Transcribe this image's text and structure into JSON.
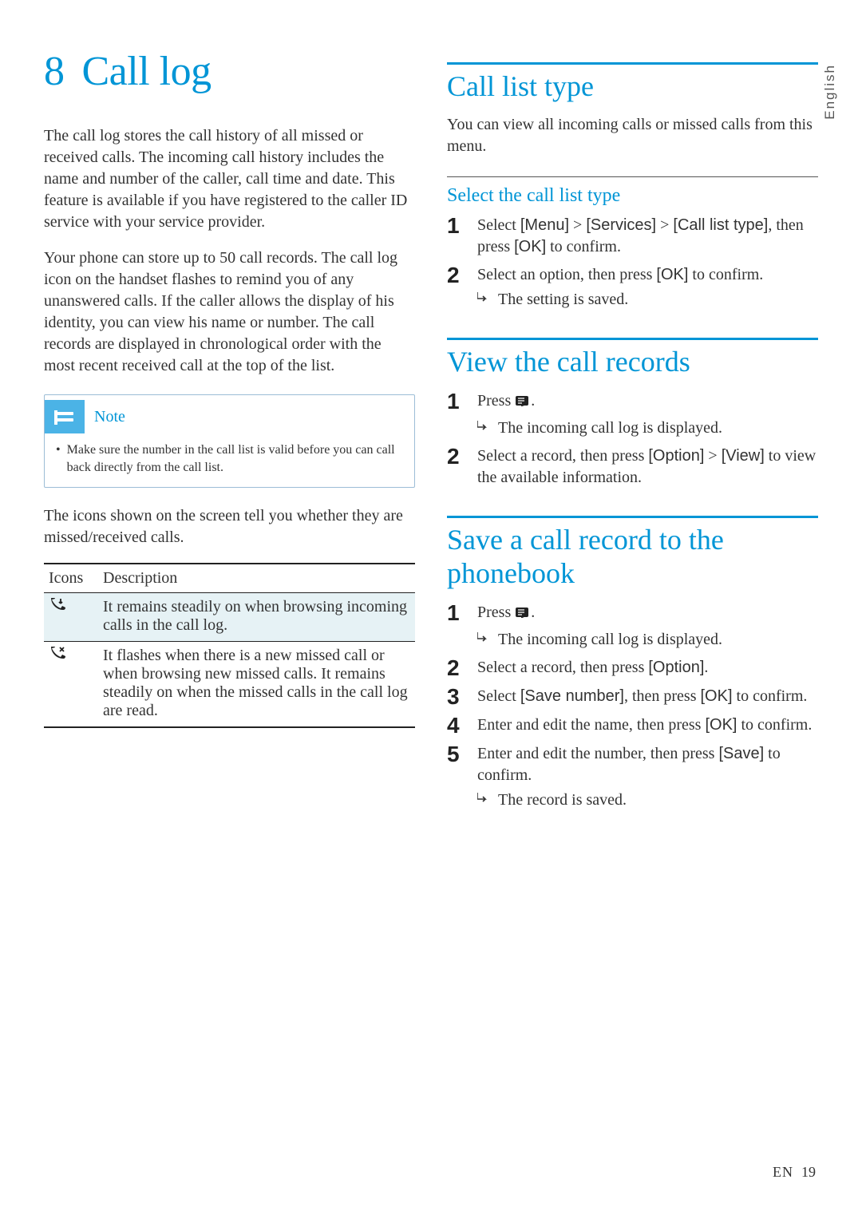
{
  "language_tab": "English",
  "chapter": {
    "number": "8",
    "title": "Call log"
  },
  "intro1": "The call log stores the call history of all missed or received calls. The incoming call history includes the name and number of the caller, call time and date. This feature is available if you have registered to the caller ID service with your service provider.",
  "intro2": "Your phone can store up to 50 call records. The call log icon on the handset flashes to remind you of any unanswered calls. If the caller allows the display of his identity, you can view his name or number. The call records are displayed in chronological order with the most recent received call at the top of the list.",
  "note": {
    "title": "Note",
    "body": "Make sure the number in the call list is valid before you can call back directly from the call list."
  },
  "icons_intro": "The icons shown on the screen tell you whether they are missed/received calls.",
  "icons_table": {
    "headers": {
      "col1": "Icons",
      "col2": "Description"
    },
    "rows": [
      {
        "desc": "It remains steadily on when browsing incoming calls in the call log."
      },
      {
        "desc": "It flashes when there is a new missed call or when browsing new missed calls. It remains steadily on when the missed calls in the call log are read."
      }
    ]
  },
  "sections": {
    "call_list_type": {
      "title": "Call list type",
      "intro": "You can view all incoming calls or missed calls from this menu.",
      "sub_title": "Select the call list type",
      "steps": [
        {
          "b1": "Select ",
          "key1": "[Menu]",
          "sep1": " > ",
          "key2": "[Services]",
          "sep2": " > ",
          "key3": "[Call list type]",
          "after": ", then press ",
          "key4": "[OK]",
          "tail": " to confirm."
        },
        {
          "b1": "Select an option, then press ",
          "key1": "[OK]",
          "tail": " to confirm.",
          "result": "The setting is saved."
        }
      ]
    },
    "view_records": {
      "title": "View the call records",
      "steps": [
        {
          "b1": "Press ",
          "tail": ".",
          "result": "The incoming call log is displayed."
        },
        {
          "b1": "Select a record, then press ",
          "key1": "[Option]",
          "sep1": " > ",
          "key2": "[View]",
          "tail": " to view the available information."
        }
      ]
    },
    "save_record": {
      "title": "Save a call record to the phonebook",
      "steps": [
        {
          "b1": "Press ",
          "tail": ".",
          "result": "The incoming call log is displayed."
        },
        {
          "b1": "Select a record, then press ",
          "key1": "[Option]",
          "tail": "."
        },
        {
          "b1": "Select ",
          "key1": "[Save number]",
          "after": ", then press ",
          "key2": "[OK]",
          "tail": " to confirm."
        },
        {
          "b1": "Enter and edit the name, then press ",
          "key1": "[OK]",
          "tail": " to confirm."
        },
        {
          "b1": "Enter and edit the number, then press ",
          "key1": "[Save]",
          "tail": " to confirm.",
          "result": "The record is saved."
        }
      ]
    }
  },
  "footer": {
    "lang": "EN",
    "page": "19"
  }
}
